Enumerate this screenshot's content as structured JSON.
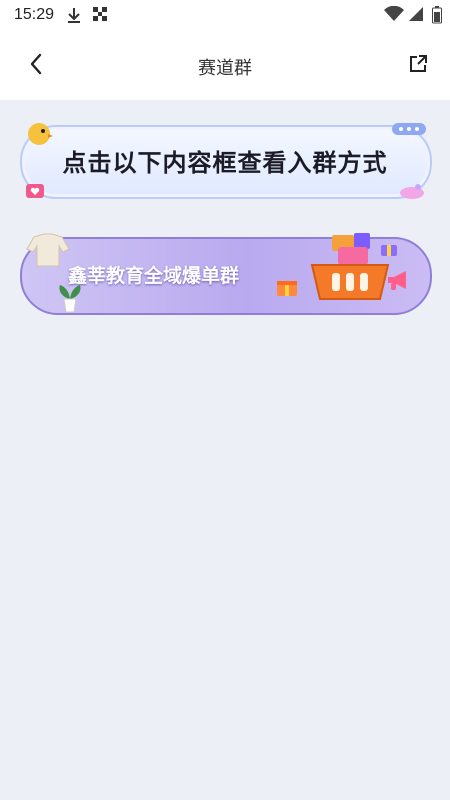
{
  "status_bar": {
    "time": "15:29",
    "icons": [
      "download-icon",
      "qr-icon",
      "wifi-icon",
      "signal-icon",
      "battery-icon"
    ]
  },
  "nav": {
    "title": "赛道群",
    "back_icon": "chevron-left-icon",
    "share_icon": "share-external-icon"
  },
  "banner": {
    "text": "点击以下内容框查看入群方式"
  },
  "groups": [
    {
      "name": "鑫莘教育全域爆单群"
    }
  ],
  "colors": {
    "background": "#eceff6",
    "banner_border": "#b9cdf6",
    "group_card": "#b9a9ef"
  }
}
